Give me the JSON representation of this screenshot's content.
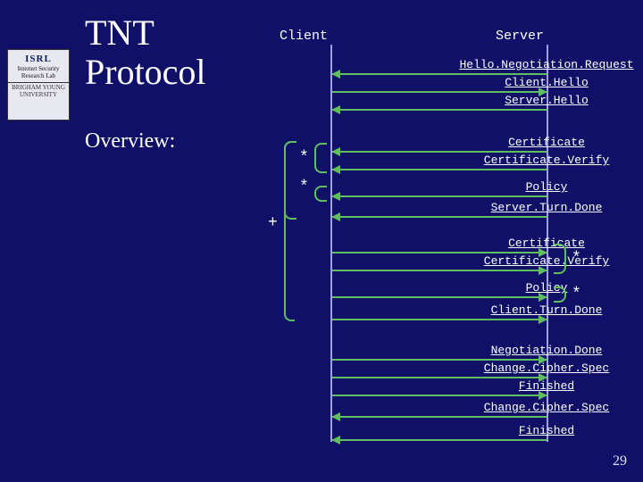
{
  "logo": {
    "acronym": "ISRL",
    "line1": "Internet Security Research Lab",
    "uni1": "BRIGHAM YOUNG",
    "uni2": "UNIVERSITY"
  },
  "title": {
    "l1": "TNT",
    "l2": "Protocol"
  },
  "overview": "Overview:",
  "cols": {
    "client": "Client",
    "server": "Server"
  },
  "m": {
    "helloReq": "Hello.Negotiation.Request",
    "clientHello": "Client.Hello",
    "serverHello": "Server.Hello",
    "cert1": "Certificate",
    "certVer1": "Certificate.Verify",
    "policy1": "Policy",
    "serverTurnDone": "Server.Turn.Done",
    "cert2": "Certificate",
    "certVer2": "Certificate.Verify",
    "policy2": "Policy",
    "clientTurnDone": "Client.Turn.Done",
    "negDone": "Negotiation.Done",
    "ccs1": "Change.Cipher.Spec",
    "fin1": "Finished",
    "ccs2": "Change.Cipher.Spec",
    "fin2": "Finished"
  },
  "sym": {
    "star": "*",
    "plus": "+"
  },
  "page": "29"
}
